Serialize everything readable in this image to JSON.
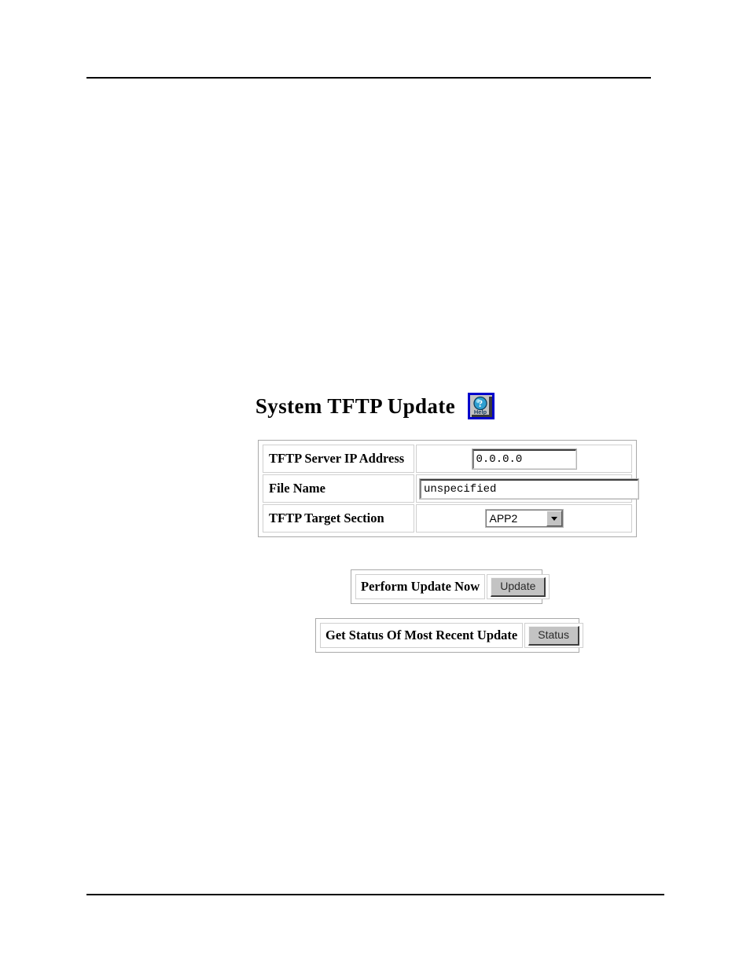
{
  "page": {
    "title": "System TFTP Update",
    "help_icon_label": "Help",
    "help_icon_glyph": "?"
  },
  "form": {
    "rows": [
      {
        "label": "TFTP Server IP Address",
        "field_type": "text",
        "value": "0.0.0.0"
      },
      {
        "label": "File Name",
        "field_type": "text",
        "value": "unspecified"
      },
      {
        "label": "TFTP Target Section",
        "field_type": "select",
        "value": "APP2"
      }
    ]
  },
  "actions": [
    {
      "label": "Perform Update Now",
      "button_label": "Update"
    },
    {
      "label": "Get Status Of Most Recent Update",
      "button_label": "Status"
    }
  ],
  "colors": {
    "help_border": "#0000cc",
    "button_face": "#c3c3c3",
    "text": "#000000",
    "rule": "#000000"
  }
}
